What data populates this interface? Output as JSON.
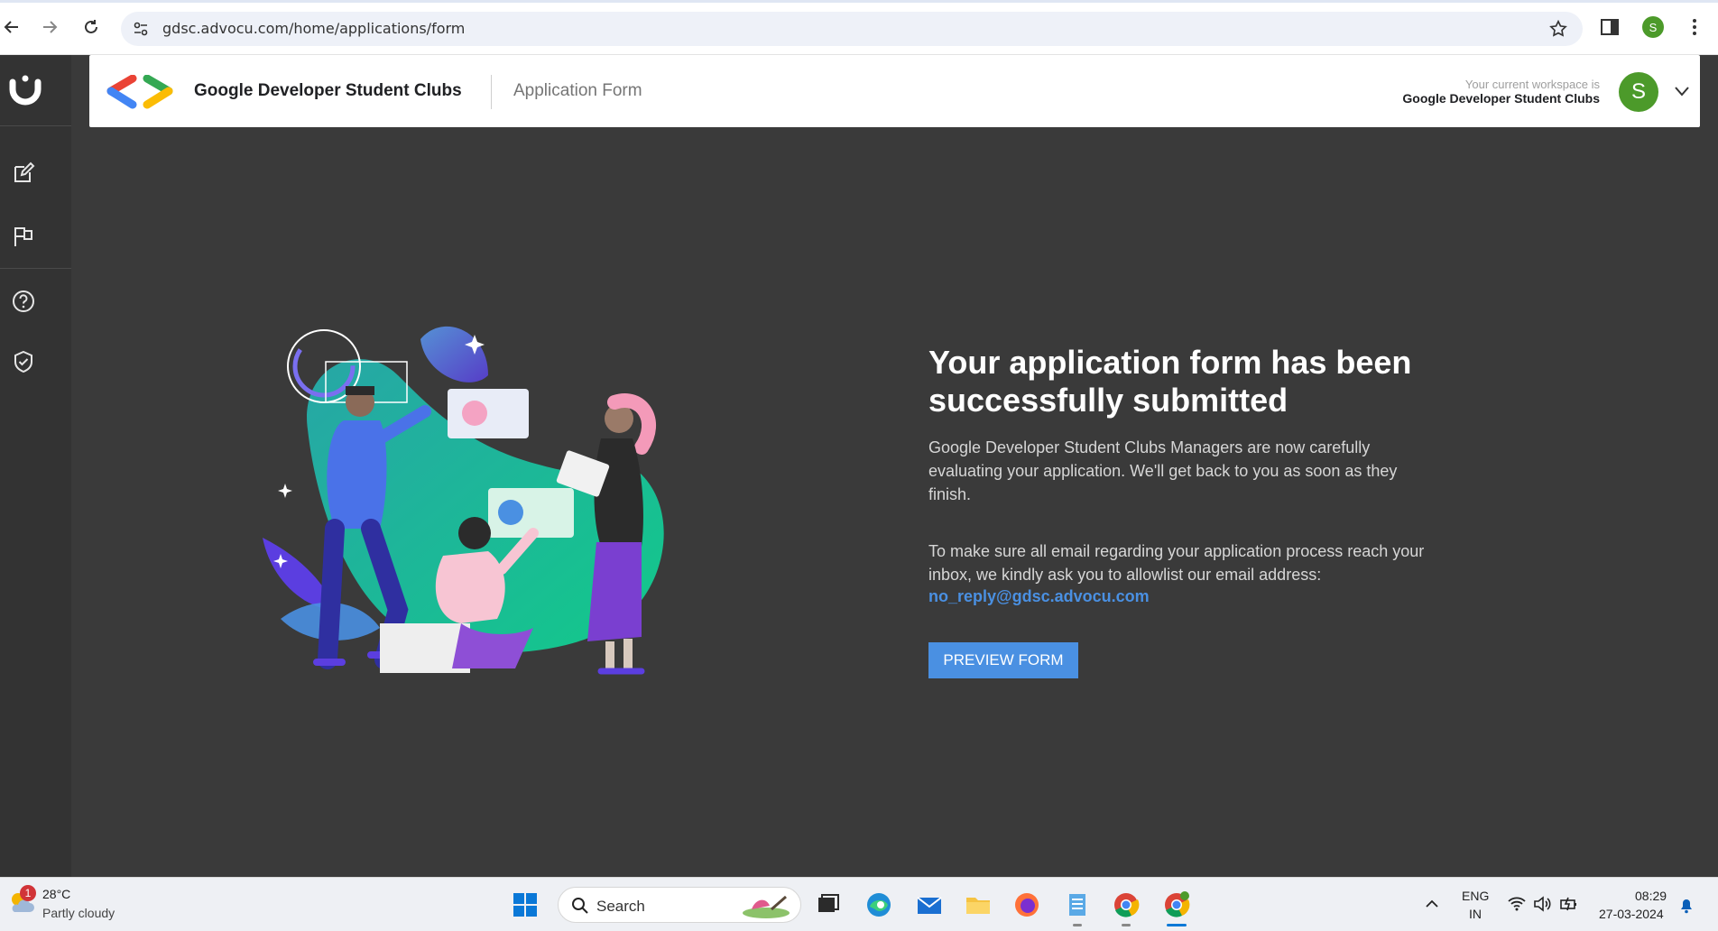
{
  "browser": {
    "url": "gdsc.advocu.com/home/applications/form",
    "profile_initial": "S"
  },
  "header": {
    "org_name": "Google Developer Student Clubs",
    "page_title": "Application Form",
    "workspace_label": "Your current workspace is",
    "workspace_name": "Google Developer Student Clubs",
    "avatar_initial": "S"
  },
  "sidebar": {
    "items": [
      {
        "icon": "edit-icon"
      },
      {
        "icon": "flag-icon"
      },
      {
        "icon": "help-icon"
      },
      {
        "icon": "shield-check-icon"
      }
    ]
  },
  "main": {
    "title": "Your application form has been successfully submitted",
    "paragraph1": "Google Developer Student Clubs Managers are now carefully evaluating your application. We'll get back to you as soon as they finish.",
    "paragraph2": "To make sure all email regarding your application process reach your inbox, we kindly ask you to allowlist our email address:",
    "email": "no_reply@gdsc.advocu.com",
    "preview_button": "PREVIEW FORM"
  },
  "taskbar": {
    "weather_temp": "28°C",
    "weather_condition": "Partly cloudy",
    "weather_badge": "1",
    "search_placeholder": "Search",
    "lang_line1": "ENG",
    "lang_line2": "IN",
    "time": "08:29",
    "date": "27-03-2024"
  },
  "colors": {
    "accent": "#4a90e2",
    "avatar": "#4c9a2a",
    "panel": "#3a3a3a",
    "rail": "#333333"
  }
}
